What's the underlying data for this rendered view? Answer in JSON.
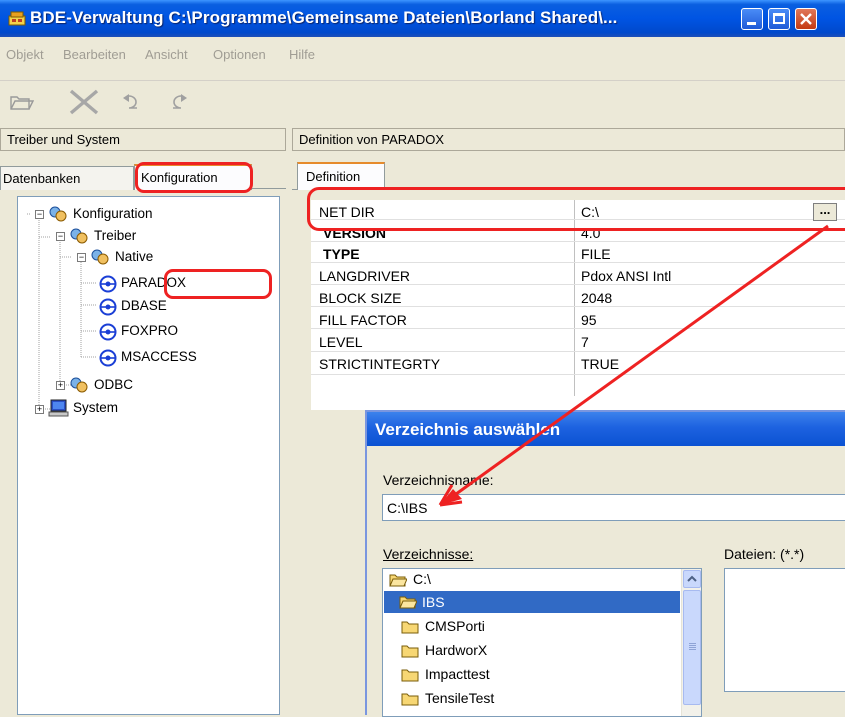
{
  "window": {
    "title": "BDE-Verwaltung  C:\\Programme\\Gemeinsame Dateien\\Borland Shared\\...",
    "colors": {
      "titlebar": "#0054e3",
      "annotation": "#e22222",
      "selection": "#316ac5"
    }
  },
  "menu": [
    "Objekt",
    "Bearbeiten",
    "Ansicht",
    "Optionen",
    "Hilfe"
  ],
  "toolbar": {
    "icons": [
      "open-icon",
      "delete-icon",
      "undo-icon",
      "redo-icon"
    ]
  },
  "left_panel": {
    "header": "Treiber und System",
    "tabs": [
      "Datenbanken",
      "Konfiguration"
    ],
    "tree": [
      {
        "label": "Konfiguration",
        "toggle": "−"
      },
      {
        "label": "Treiber",
        "toggle": "−"
      },
      {
        "label": "Native",
        "toggle": "−"
      },
      {
        "label": "PARADOX"
      },
      {
        "label": "DBASE"
      },
      {
        "label": "FOXPRO"
      },
      {
        "label": "MSACCESS"
      },
      {
        "label": "ODBC",
        "toggle": "+"
      },
      {
        "label": "System",
        "toggle": "+"
      }
    ]
  },
  "right_panel": {
    "header": "Definition von PARADOX",
    "tab": "Definition",
    "rows": [
      {
        "key": "NET DIR",
        "value": "C:\\",
        "button": "..."
      },
      {
        "key": "VERSION",
        "value": "4.0"
      },
      {
        "key": "TYPE",
        "value": "FILE"
      },
      {
        "key": "LANGDRIVER",
        "value": "Pdox ANSI Intl"
      },
      {
        "key": "BLOCK SIZE",
        "value": "2048"
      },
      {
        "key": "FILL FACTOR",
        "value": "95"
      },
      {
        "key": "LEVEL",
        "value": "7"
      },
      {
        "key": "STRICTINTEGRTY",
        "value": "TRUE"
      }
    ]
  },
  "dialog": {
    "title": "Verzeichnis auswählen",
    "dir_label": "Verzeichnisname:",
    "dir_value": "C:\\IBS",
    "folders_label": "Verzeichnisse:",
    "files_label": "Dateien: (*.*)",
    "folders": [
      "C:\\",
      "IBS",
      "CMSPorti",
      "HardworX",
      "Impacttest",
      "TensileTest"
    ]
  }
}
